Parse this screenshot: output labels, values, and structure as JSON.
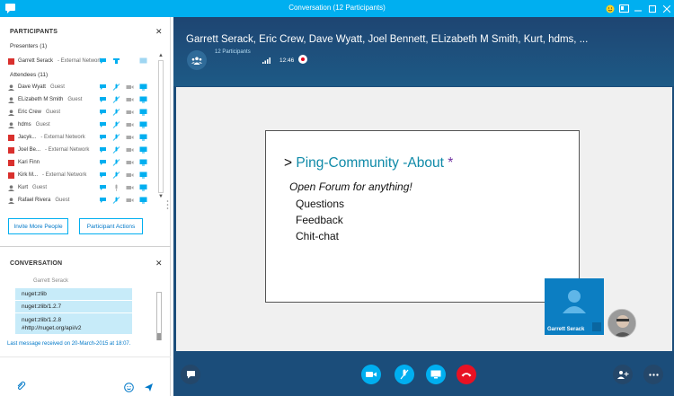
{
  "window": {
    "title": "Conversation (12 Participants)"
  },
  "participants_panel": {
    "title": "PARTICIPANTS",
    "presenters_label": "Presenters (1)",
    "attendees_label": "Attendees (11)",
    "people": [
      {
        "name": "Garrett Serack",
        "tag": "- External Network",
        "avatar": "red"
      },
      {
        "name": "Dave Wyatt",
        "tag": "Guest",
        "avatar": "grey"
      },
      {
        "name": "ELizabeth M Smith",
        "tag": "Guest",
        "avatar": "grey"
      },
      {
        "name": "Eric Crew",
        "tag": "Guest",
        "avatar": "grey"
      },
      {
        "name": "hdms",
        "tag": "Guest",
        "avatar": "grey"
      },
      {
        "name": "Jacyk...",
        "tag": "- External Network",
        "avatar": "red"
      },
      {
        "name": "Joel Be...",
        "tag": "- External Network",
        "avatar": "red"
      },
      {
        "name": "Kari Finn",
        "tag": "",
        "avatar": "red"
      },
      {
        "name": "Kirk M...",
        "tag": "- External Network",
        "avatar": "red"
      },
      {
        "name": "Kurt",
        "tag": "Guest",
        "avatar": "grey"
      },
      {
        "name": "Rafael Rivera",
        "tag": "Guest",
        "avatar": "grey"
      }
    ],
    "invite_button": "Invite More People",
    "actions_button": "Participant Actions"
  },
  "conversation_panel": {
    "title": "CONVERSATION",
    "sender": "Garrett Serack",
    "messages": [
      "nuget:zlib",
      "nuget:zlib/1.2.7",
      "nuget:zlib/1.2.8",
      "#http://nuget.org/api/v2"
    ],
    "last_received": "Last message received on 20-March-2015 at 18:07."
  },
  "call": {
    "title": "Garrett Serack, Eric Crew, Dave Wyatt, Joel Bennett, ELizabeth M Smith, Kurt, hdms, ...",
    "participants_count": "12 Participants",
    "time": "12:46"
  },
  "slide": {
    "title_prefix": "> ",
    "title_main": "Ping-Community -About",
    "title_star": " *",
    "subtitle": "Open Forum for anything!",
    "items": [
      "Questions",
      "Feedback",
      "Chit-chat"
    ]
  },
  "self_view": {
    "label": "Garrett Serack"
  },
  "colors": {
    "accent": "#00aff0",
    "call_bg": "#1b4d7a",
    "hangup": "#e81123",
    "bubble": "#c7ebf9"
  }
}
